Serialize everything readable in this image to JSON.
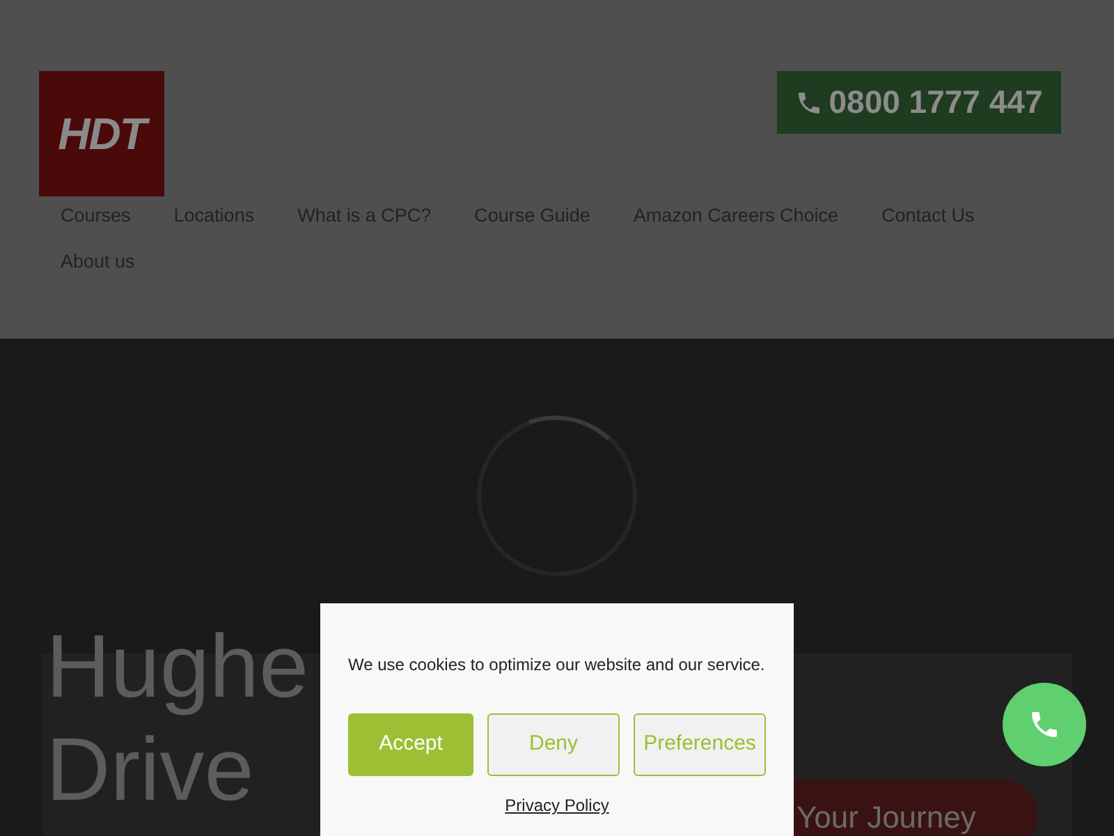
{
  "logo": {
    "text": "HDT"
  },
  "phone_button": {
    "label": "0800 1777 447"
  },
  "nav": [
    {
      "label": "Courses"
    },
    {
      "label": "Locations"
    },
    {
      "label": "What is a CPC?"
    },
    {
      "label": "Course Guide"
    },
    {
      "label": "Amazon Careers Choice"
    },
    {
      "label": "Contact Us"
    },
    {
      "label": "About us"
    }
  ],
  "hero": {
    "headline_lines": [
      "Hughe",
      "Drive"
    ],
    "cta": "Your Journey"
  },
  "cookie_dialog": {
    "message": "We use cookies to optimize our website and our service.",
    "buttons": [
      {
        "label": "Accept",
        "kind": "primary"
      },
      {
        "label": "Deny",
        "kind": "outline"
      },
      {
        "label": "Preferences",
        "kind": "outline"
      }
    ],
    "link": "Privacy Policy"
  }
}
